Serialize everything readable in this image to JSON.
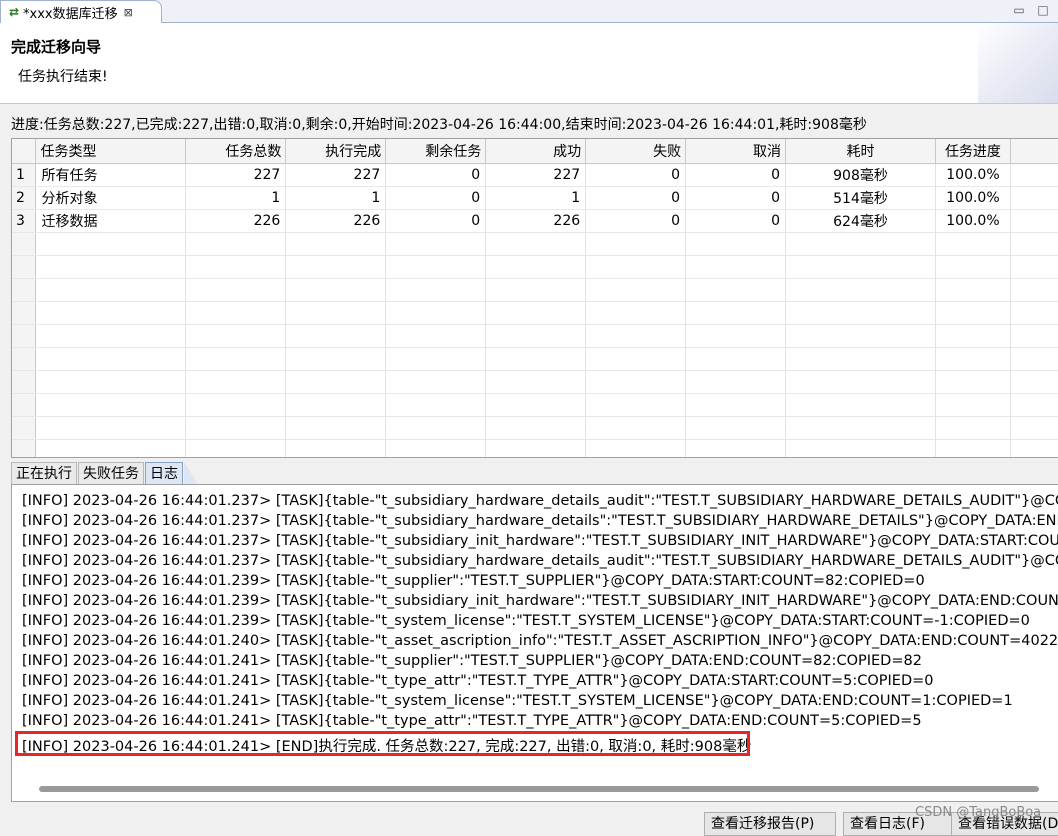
{
  "editor": {
    "tab_title": "*xxx数据库迁移",
    "icon": "migrate-arrows-icon",
    "close": "⊠"
  },
  "header": {
    "title": "完成迁移向导",
    "message": "任务执行结束!"
  },
  "progress_text": "进度:任务总数:227,已完成:227,出错:0,取消:0,剩余:0,开始时间:2023-04-26 16:44:00,结束时间:2023-04-26 16:44:01,耗时:908毫秒",
  "table": {
    "columns": [
      "任务类型",
      "任务总数",
      "执行完成",
      "剩余任务",
      "成功",
      "失败",
      "取消",
      "耗时",
      "任务进度"
    ],
    "rows": [
      {
        "n": "1",
        "cells": [
          "所有任务",
          "227",
          "227",
          "0",
          "227",
          "0",
          "0",
          "908毫秒",
          "100.0%"
        ]
      },
      {
        "n": "2",
        "cells": [
          "分析对象",
          "1",
          "1",
          "0",
          "1",
          "0",
          "0",
          "514毫秒",
          "100.0%"
        ]
      },
      {
        "n": "3",
        "cells": [
          "迁移数据",
          "226",
          "226",
          "0",
          "226",
          "0",
          "0",
          "624毫秒",
          "100.0%"
        ]
      }
    ]
  },
  "bottom_tabs": [
    "正在执行",
    "失败任务",
    "日志"
  ],
  "log_lines": [
    "[INFO] 2023-04-26 16:44:01.237> [TASK]{table-\"t_subsidiary_hardware_details_audit\":\"TEST.T_SUBSIDIARY_HARDWARE_DETAILS_AUDIT\"}@COI",
    "[INFO] 2023-04-26 16:44:01.237> [TASK]{table-\"t_subsidiary_hardware_details\":\"TEST.T_SUBSIDIARY_HARDWARE_DETAILS\"}@COPY_DATA:END",
    "[INFO] 2023-04-26 16:44:01.237> [TASK]{table-\"t_subsidiary_init_hardware\":\"TEST.T_SUBSIDIARY_INIT_HARDWARE\"}@COPY_DATA:START:COU",
    "[INFO] 2023-04-26 16:44:01.237> [TASK]{table-\"t_subsidiary_hardware_details_audit\":\"TEST.T_SUBSIDIARY_HARDWARE_DETAILS_AUDIT\"}@COI",
    "[INFO] 2023-04-26 16:44:01.239> [TASK]{table-\"t_supplier\":\"TEST.T_SUPPLIER\"}@COPY_DATA:START:COUNT=82:COPIED=0",
    "[INFO] 2023-04-26 16:44:01.239> [TASK]{table-\"t_subsidiary_init_hardware\":\"TEST.T_SUBSIDIARY_INIT_HARDWARE\"}@COPY_DATA:END:COUNT",
    "[INFO] 2023-04-26 16:44:01.239> [TASK]{table-\"t_system_license\":\"TEST.T_SYSTEM_LICENSE\"}@COPY_DATA:START:COUNT=-1:COPIED=0",
    "[INFO] 2023-04-26 16:44:01.240> [TASK]{table-\"t_asset_ascription_info\":\"TEST.T_ASSET_ASCRIPTION_INFO\"}@COPY_DATA:END:COUNT=4022:(",
    "[INFO] 2023-04-26 16:44:01.241> [TASK]{table-\"t_supplier\":\"TEST.T_SUPPLIER\"}@COPY_DATA:END:COUNT=82:COPIED=82",
    "[INFO] 2023-04-26 16:44:01.241> [TASK]{table-\"t_type_attr\":\"TEST.T_TYPE_ATTR\"}@COPY_DATA:START:COUNT=5:COPIED=0",
    "[INFO] 2023-04-26 16:44:01.241> [TASK]{table-\"t_system_license\":\"TEST.T_SYSTEM_LICENSE\"}@COPY_DATA:END:COUNT=1:COPIED=1",
    "[INFO] 2023-04-26 16:44:01.241> [TASK]{table-\"t_type_attr\":\"TEST.T_TYPE_ATTR\"}@COPY_DATA:END:COUNT=5:COPIED=5",
    "[INFO] 2023-04-26 16:44:01.241> [END]执行完成. 任务总数:227, 完成:227, 出错:0, 取消:0, 耗时:908毫秒"
  ],
  "buttons": {
    "report": "查看迁移报告(P)",
    "log": "查看日志(F)",
    "errors": "查看错误数据(D"
  },
  "watermark": "CSDN @TangBoBoa",
  "colors": {
    "highlight": "#e8262a",
    "active_tab": "#dde6f3"
  }
}
